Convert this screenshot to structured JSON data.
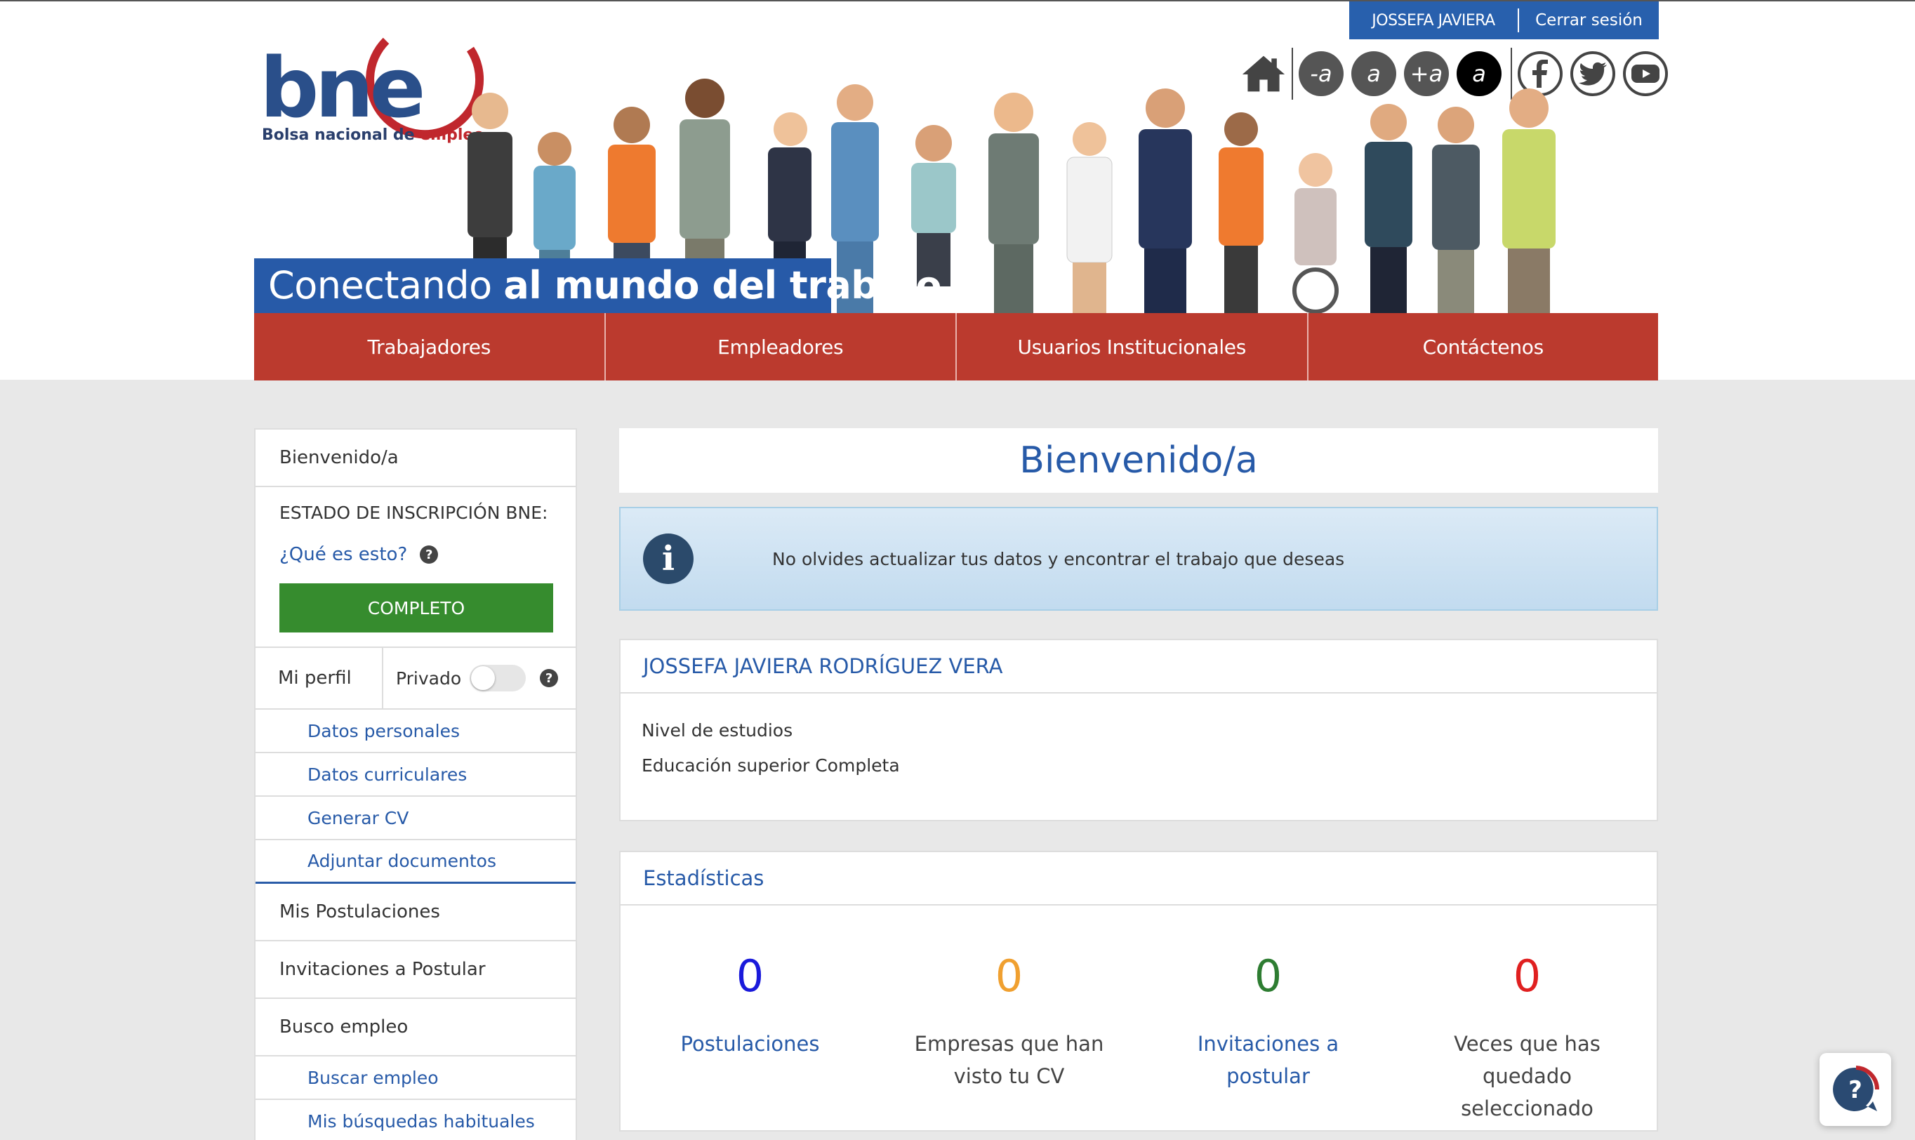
{
  "user_bar": {
    "name": "JOSSEFA JAVIERA",
    "logout": "Cerrar sesión"
  },
  "logo": {
    "mark": "bne",
    "subtitle_main": "Bolsa nacional de ",
    "subtitle_accent": "empleo"
  },
  "toolbar": {
    "home_icon": "home-icon",
    "font_decrease": "-a",
    "font_normal": "a",
    "font_increase": "+a",
    "contrast": "a",
    "social": [
      "facebook-icon",
      "twitter-icon",
      "youtube-icon"
    ]
  },
  "slogan": {
    "normal": "Conectando ",
    "bold": "al mundo del trabajo"
  },
  "nav": [
    "Trabajadores",
    "Empleadores",
    "Usuarios Institucionales",
    "Contáctenos"
  ],
  "sidebar": {
    "welcome": "Bienvenido/a",
    "status_title": "ESTADO DE INSCRIPCIÓN BNE:",
    "what_link": "¿Qué es esto?",
    "status_value": "COMPLETO",
    "profile_label": "Mi perfil",
    "private_label": "Privado",
    "private_on": false,
    "profile_items": [
      "Datos personales",
      "Datos curriculares",
      "Generar CV",
      "Adjuntar documentos"
    ],
    "postulaciones": "Mis Postulaciones",
    "invitaciones": "Invitaciones a Postular",
    "busco": "Busco empleo",
    "job_items": [
      "Buscar empleo",
      "Mis búsquedas habituales"
    ]
  },
  "main": {
    "welcome_title": "Bienvenido/a",
    "alert_message": "No olvides actualizar tus datos y encontrar el trabajo que deseas",
    "profile": {
      "name": "JOSSEFA JAVIERA RODRÍGUEZ VERA",
      "edu_label": "Nivel de estudios",
      "edu_value": "Educación superior Completa"
    },
    "stats": {
      "title": "Estadísticas",
      "items": [
        {
          "value": "0",
          "label": "Postulaciones",
          "color": "#1a1adb",
          "label_color": "#275aa8"
        },
        {
          "value": "0",
          "label": "Empresas que han visto tu CV",
          "color": "#f0a030",
          "label_color": "#444444"
        },
        {
          "value": "0",
          "label": "Invitaciones a postular",
          "color": "#2e7d32",
          "label_color": "#275aa8"
        },
        {
          "value": "0",
          "label": "Veces que has quedado seleccionado",
          "color": "#e02020",
          "label_color": "#444444"
        }
      ]
    }
  },
  "colors": {
    "brand_blue": "#275aa8",
    "nav_red": "#bb3a2e",
    "success_green": "#368c2e"
  }
}
